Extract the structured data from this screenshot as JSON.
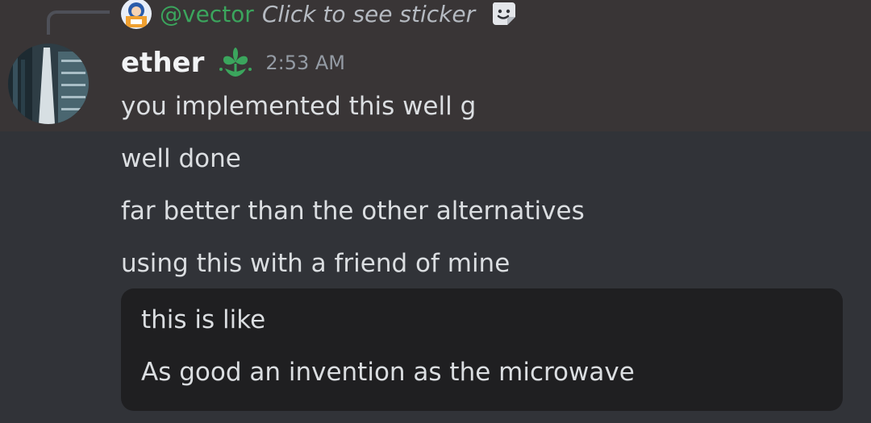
{
  "reply": {
    "username": "@vector",
    "text": "Click to see sticker",
    "sticker_icon": "sticker-icon"
  },
  "message": {
    "username": "ether",
    "role_icon": "green-flower-role-icon",
    "timestamp": "2:53 AM",
    "lines": [
      "you implemented this well g",
      "well done",
      "far better than the other alternatives",
      "using this with a friend of mine"
    ]
  },
  "embed": {
    "lines": [
      "this is like",
      "As good an invention as the microwave"
    ]
  },
  "colors": {
    "background": "#313338",
    "highlight": "#393536",
    "mention_green": "#3ba55d",
    "embed_bg": "#1f1f21"
  }
}
